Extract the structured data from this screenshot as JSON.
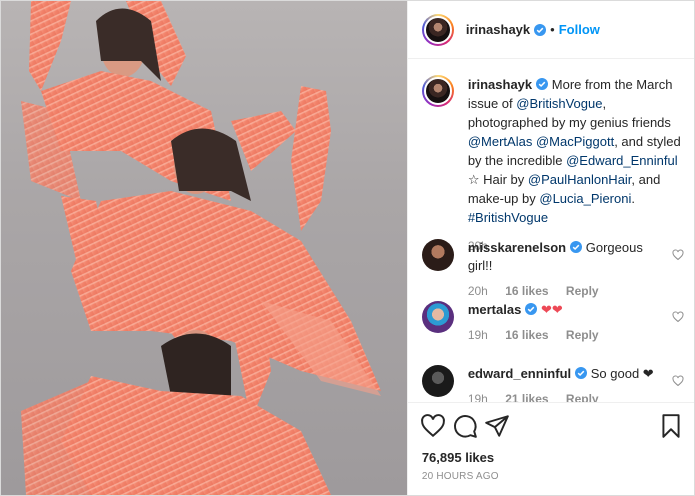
{
  "header": {
    "username": "irinashayk",
    "dot": "•",
    "follow_label": "Follow"
  },
  "caption": {
    "username": "irinashayk",
    "parts": {
      "t1": "More from the March issue of ",
      "m1": "@BritishVogue",
      "t2": ", photographed by my genius friends ",
      "m2": "@MertAlas",
      "t3": " ",
      "m3": "@MacPiggott",
      "t4": ", and styled by the incredible ",
      "m4": "@Edward_Enninful",
      "t5": " ☆ Hair by ",
      "m5": "@PaulHanlonHair",
      "t6": ", and make-up by ",
      "m6": "@Lucia_Pieroni",
      "t7": ". ",
      "m7": "#BritishVogue"
    },
    "time": "20h"
  },
  "comments": [
    {
      "username": "misskarenelson",
      "verified": true,
      "text": "Gorgeous girl!!",
      "time": "20h",
      "likes": "16 likes",
      "reply": "Reply"
    },
    {
      "username": "mertalas",
      "verified": true,
      "text": "❤❤",
      "time": "19h",
      "likes": "16 likes",
      "reply": "Reply"
    },
    {
      "username": "edward_enninful",
      "verified": true,
      "text": "So good ❤",
      "time": "19h",
      "likes": "21 likes",
      "reply": "Reply"
    }
  ],
  "actions": {
    "icons": [
      "heart-icon",
      "comment-icon",
      "share-icon",
      "bookmark-icon"
    ]
  },
  "likes_label": "76,895 likes",
  "date_label": "20 HOURS AGO",
  "colors": {
    "link": "#00376b",
    "follow": "#0095f6",
    "meta": "#8e8e8e",
    "heart": "#ed4956",
    "verified": "#3897f0",
    "dress": "#f3886f"
  }
}
